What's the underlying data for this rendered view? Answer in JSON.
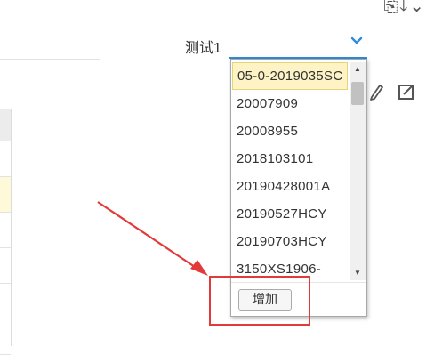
{
  "select": {
    "value": "测试1",
    "caret_icon": "chevron-down-icon",
    "accent_color": "#2e8bd8"
  },
  "dropdown": {
    "options": [
      "05-0-2019035SC",
      "20007909",
      "20008955",
      "2018103101",
      "20190428001A",
      "20190527HCY",
      "20190703HCY",
      "3150XS1906-"
    ],
    "selected_index": 0,
    "add_button_label": "增加"
  },
  "toolbar": {
    "icons": [
      "edit-icon",
      "export-icon"
    ]
  },
  "annotation": {
    "color": "#e23a3a"
  }
}
